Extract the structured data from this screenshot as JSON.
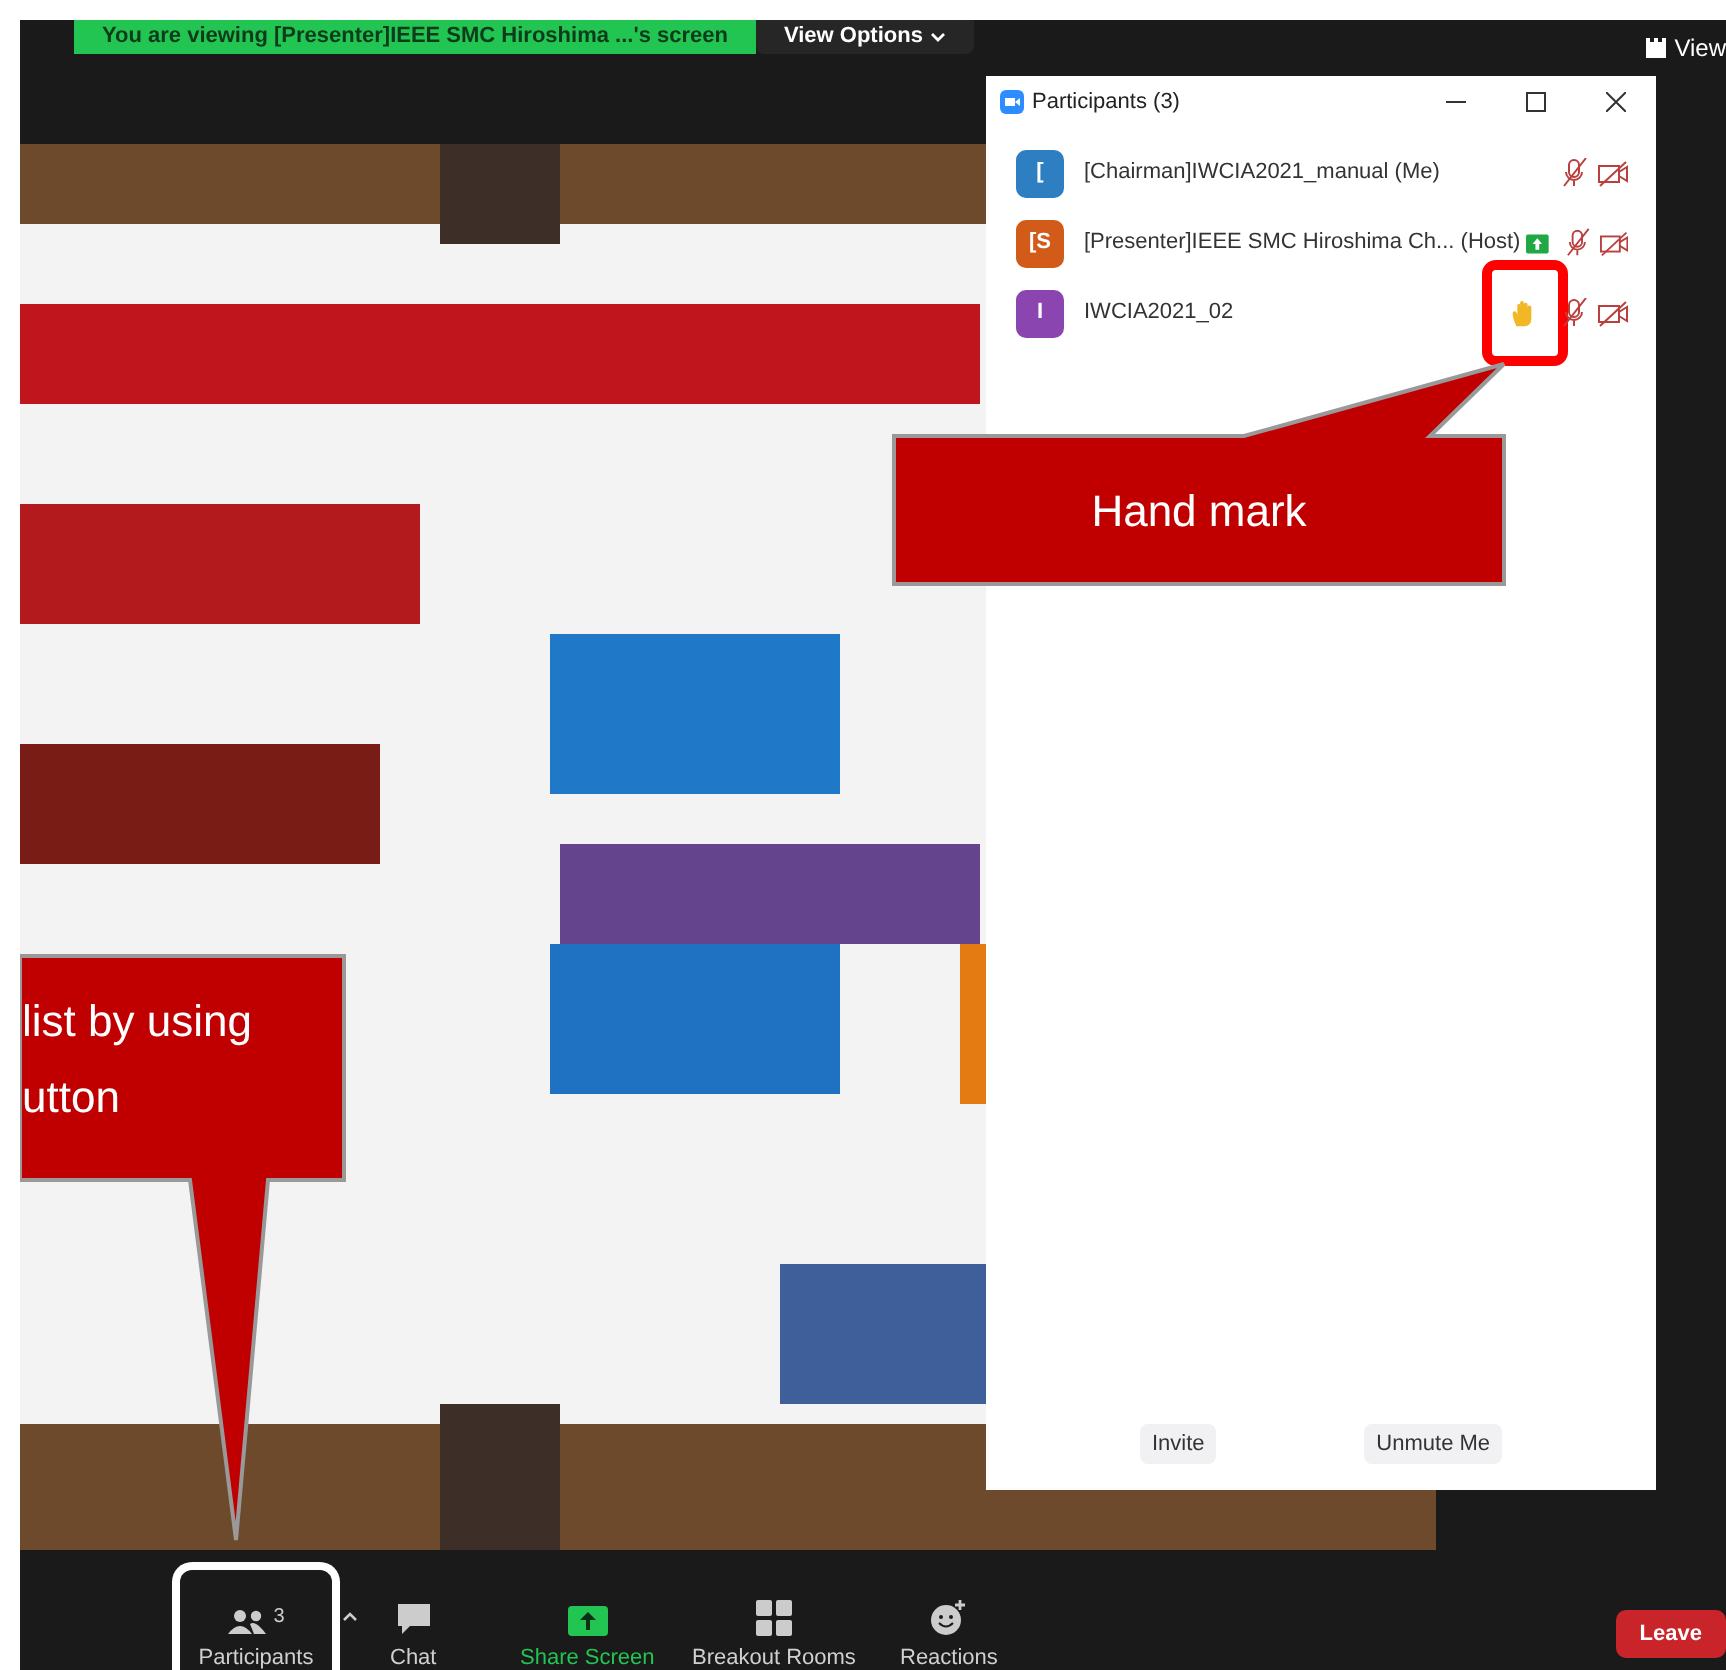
{
  "top_bar": {
    "viewing_banner": "You are viewing [Presenter]IEEE SMC Hiroshima ...'s screen",
    "view_options": "View Options",
    "view_button": "View"
  },
  "participants_panel": {
    "title": "Participants (3)",
    "participants": [
      {
        "initial": "[",
        "name": "[Chairman]IWCIA2021_manual (Me)",
        "color": "#2d7fc1",
        "sharing": false,
        "hand_raised": false
      },
      {
        "initial": "[S",
        "name": "[Presenter]IEEE SMC Hiroshima Ch... (Host)",
        "color": "#d35b1a",
        "sharing": true,
        "hand_raised": false
      },
      {
        "initial": "I",
        "name": "IWCIA2021_02",
        "color": "#8a45b0",
        "sharing": false,
        "hand_raised": true
      }
    ],
    "buttons": [
      "Invite",
      "Unmute Me"
    ]
  },
  "annotations": [
    {
      "kind": "hand",
      "lines": [
        "Hand mark"
      ]
    },
    {
      "kind": "participants",
      "lines": [
        "list by using",
        "utton"
      ]
    }
  ],
  "toolbar": {
    "items": [
      {
        "kind": "participants",
        "label": "Participants",
        "count": "3"
      },
      {
        "kind": "chat",
        "label": "Chat"
      },
      {
        "kind": "share",
        "label": "Share Screen"
      },
      {
        "kind": "breakout",
        "label": "Breakout Rooms"
      },
      {
        "kind": "reactions",
        "label": "Reactions"
      }
    ],
    "leave": "Leave"
  }
}
